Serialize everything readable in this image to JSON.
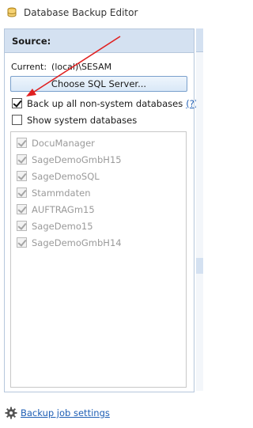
{
  "window": {
    "title": "Database Backup Editor",
    "icon": "database-icon"
  },
  "source": {
    "header": "Source:",
    "current_label": "Current:",
    "current_value": "(local)\\SESAM",
    "choose_button": "Choose SQL Server...",
    "backup_all": {
      "label": "Back up all non-system databases",
      "checked": true
    },
    "help_link": "(?)",
    "show_system": {
      "label": "Show system databases",
      "checked": false
    },
    "databases": [
      {
        "name": "DocuManager",
        "checked": true
      },
      {
        "name": "SageDemoGmbH15",
        "checked": true
      },
      {
        "name": "SageDemoSQL",
        "checked": true
      },
      {
        "name": "Stammdaten",
        "checked": true
      },
      {
        "name": "AUFTRAGm15",
        "checked": true
      },
      {
        "name": "SageDemo15",
        "checked": true
      },
      {
        "name": "SageDemoGmbH14",
        "checked": true
      }
    ]
  },
  "footer": {
    "settings_link": "Backup job settings",
    "icon": "gear-icon"
  },
  "colors": {
    "header_bg": "#d4e1f1",
    "link": "#1f5fb5",
    "annotation_arrow": "#e02020"
  }
}
